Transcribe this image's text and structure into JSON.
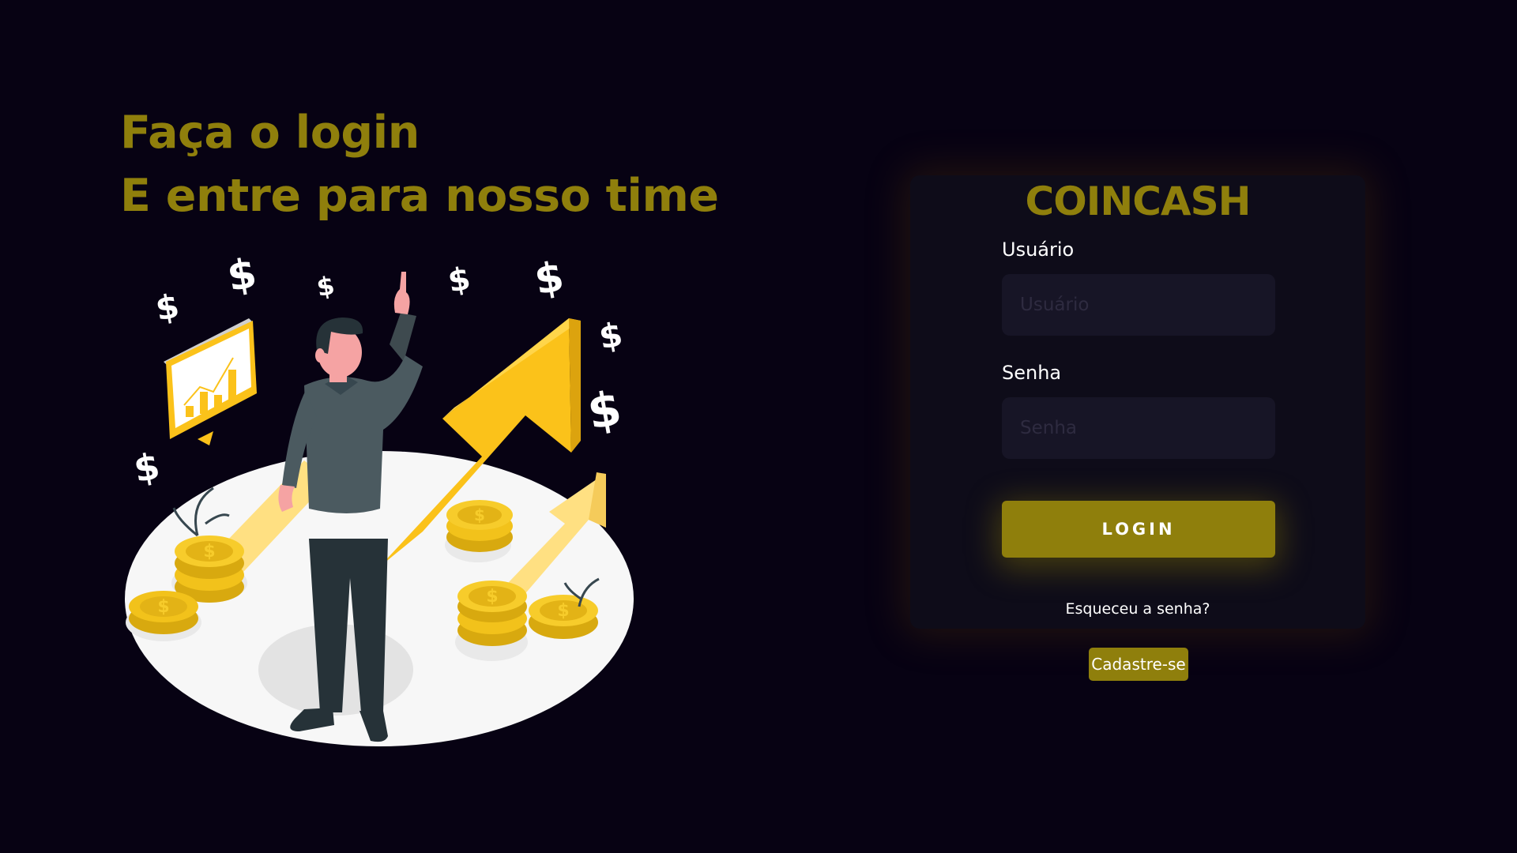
{
  "hero": {
    "line1": "Faça o login",
    "line2": "E entre para nosso time"
  },
  "login_card": {
    "brand": "COINCASH",
    "username": {
      "label": "Usuário",
      "placeholder": "Usuário",
      "value": ""
    },
    "password": {
      "label": "Senha",
      "placeholder": "Senha",
      "value": ""
    },
    "login_button": "LOGIN",
    "forgot_link": "Esqueceu a senha?"
  },
  "register_button": "Cadastre-se",
  "colors": {
    "background": "#070213",
    "accent": "#8f7f0c",
    "card": "#0e0c19",
    "input": "#171526"
  }
}
